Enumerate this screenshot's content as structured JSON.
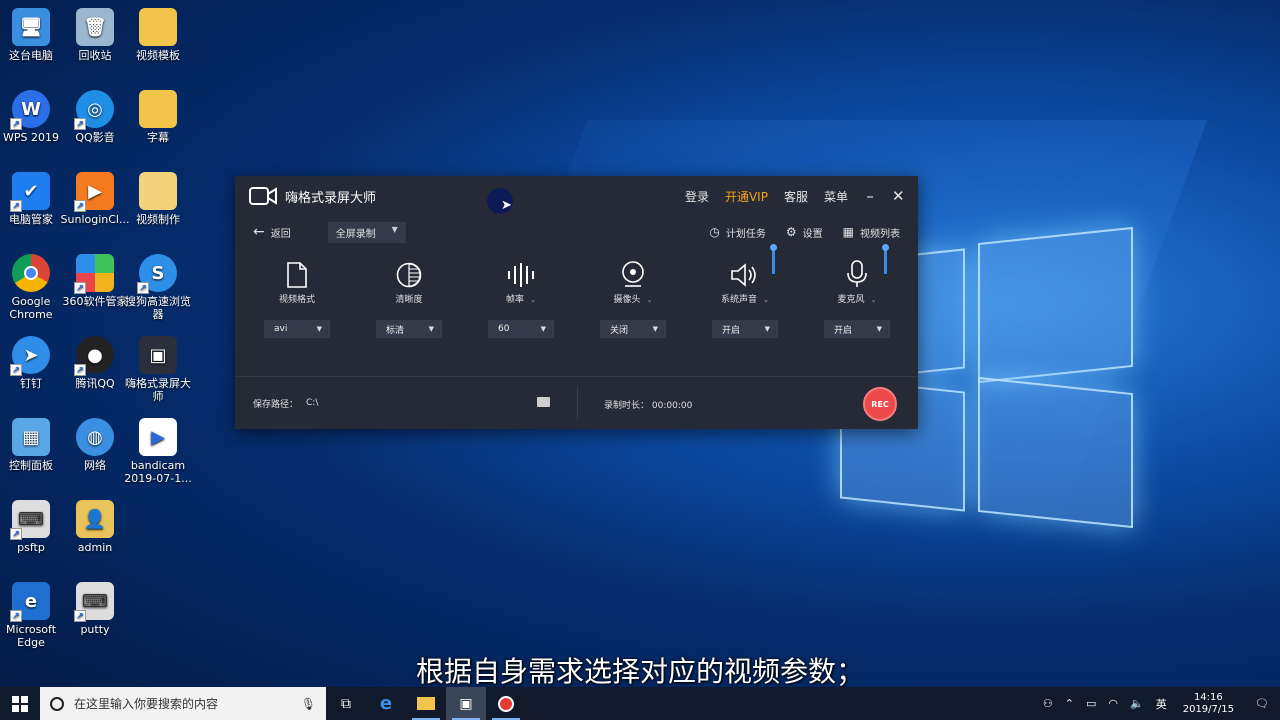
{
  "desktop": {
    "icons": [
      {
        "label": "这台电脑"
      },
      {
        "label": "回收站"
      },
      {
        "label": "视频模板"
      },
      {
        "label": "WPS 2019"
      },
      {
        "label": "QQ影音"
      },
      {
        "label": "字幕"
      },
      {
        "label": "电脑管家"
      },
      {
        "label": "SunloginCl..."
      },
      {
        "label": "视频制作"
      },
      {
        "label": "Google Chrome"
      },
      {
        "label": "360软件管家"
      },
      {
        "label": "搜狗高速浏览器"
      },
      {
        "label": "钉钉"
      },
      {
        "label": "腾讯QQ"
      },
      {
        "label": "嗨格式录屏大师"
      },
      {
        "label": "控制面板"
      },
      {
        "label": "网络"
      },
      {
        "label": "bandicam 2019-07-1..."
      },
      {
        "label": "psftp"
      },
      {
        "label": "admin"
      },
      {
        "label": "Microsoft Edge"
      },
      {
        "label": "putty"
      }
    ]
  },
  "app": {
    "title": "嗨格式录屏大师",
    "login": "登录",
    "vip": "开通VIP",
    "service": "客服",
    "menu": "菜单",
    "minimize": "–",
    "close": "✕",
    "back": "返回",
    "mode": "全屏录制",
    "schedule": "计划任务",
    "settings": "设置",
    "video_list": "视频列表",
    "controls": [
      {
        "label": "视频格式",
        "value": "avi"
      },
      {
        "label": "清晰度",
        "value": "标清"
      },
      {
        "label": "帧率",
        "value": "60"
      },
      {
        "label": "摄像头",
        "value": "关闭"
      },
      {
        "label": "系统声音",
        "value": "开启"
      },
      {
        "label": "麦克风",
        "value": "开启"
      }
    ],
    "save_path_label": "保存路径：",
    "save_path": "C:\\",
    "duration_label": "录制时长：",
    "duration": "00:00:00",
    "rec": "REC"
  },
  "subtitle": "根据自身需求选择对应的视频参数；",
  "taskbar": {
    "search_placeholder": "在这里输入你要搜索的内容",
    "ime": "英",
    "time": "14:16",
    "date": "2019/7/15"
  },
  "colors": {
    "vip": "#f4a21d",
    "rec": "#ec4a4a",
    "window": "#262a36"
  }
}
